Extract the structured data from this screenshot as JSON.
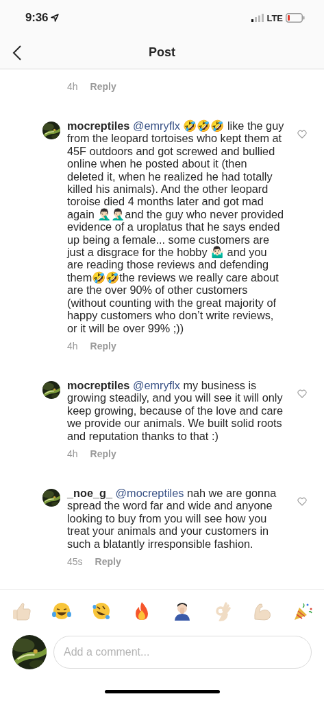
{
  "status_bar": {
    "time": "9:36",
    "network": "LTE"
  },
  "nav": {
    "title": "Post"
  },
  "comments": [
    {
      "kind": "partial",
      "time": "4h",
      "reply": "Reply"
    },
    {
      "kind": "full",
      "user": "mocreptiles",
      "mention": "@emryflx",
      "text": "🤣🤣🤣 like the guy from the leopard tortoises who kept them at 45F outdoors and got screwed and bullied online when he posted about it (then deleted it, when he realized he had totally killed his animals). And the other leopard toroise died 4 months later and got mad again 🤦🏻‍♂️🤦🏻‍♂️and the guy who never provided evidence of a uroplatus that he says ended up being a female... some customers are just a disgrace for the hobby 🤷🏻‍♂️ and you are reading those reviews and defending them🤣🤣the reviews we really care about are the over 90% of other customers (without counting with the great majority of happy customers who don’t write reviews, or it will be over 99% ;))",
      "time": "4h",
      "reply": "Reply",
      "liked": false
    },
    {
      "kind": "full",
      "user": "mocreptiles",
      "mention": "@emryflx",
      "text": "my business is growing steadily, and you will see it will only keep growing, because of the love and care we provide our animals. We built solid roots and reputation thanks to that :)",
      "time": "4h",
      "reply": "Reply",
      "liked": false
    },
    {
      "kind": "full",
      "user": "_noe_g_",
      "mention": "@mocreptiles",
      "text": "nah we are gonna spread the word far and wide and anyone looking to buy from you will see how you treat your animals and your customers in such a blatantly irresponsible fashion.",
      "time": "45s",
      "reply": "Reply",
      "liked": false
    }
  ],
  "composer": {
    "placeholder": "Add a comment..."
  }
}
